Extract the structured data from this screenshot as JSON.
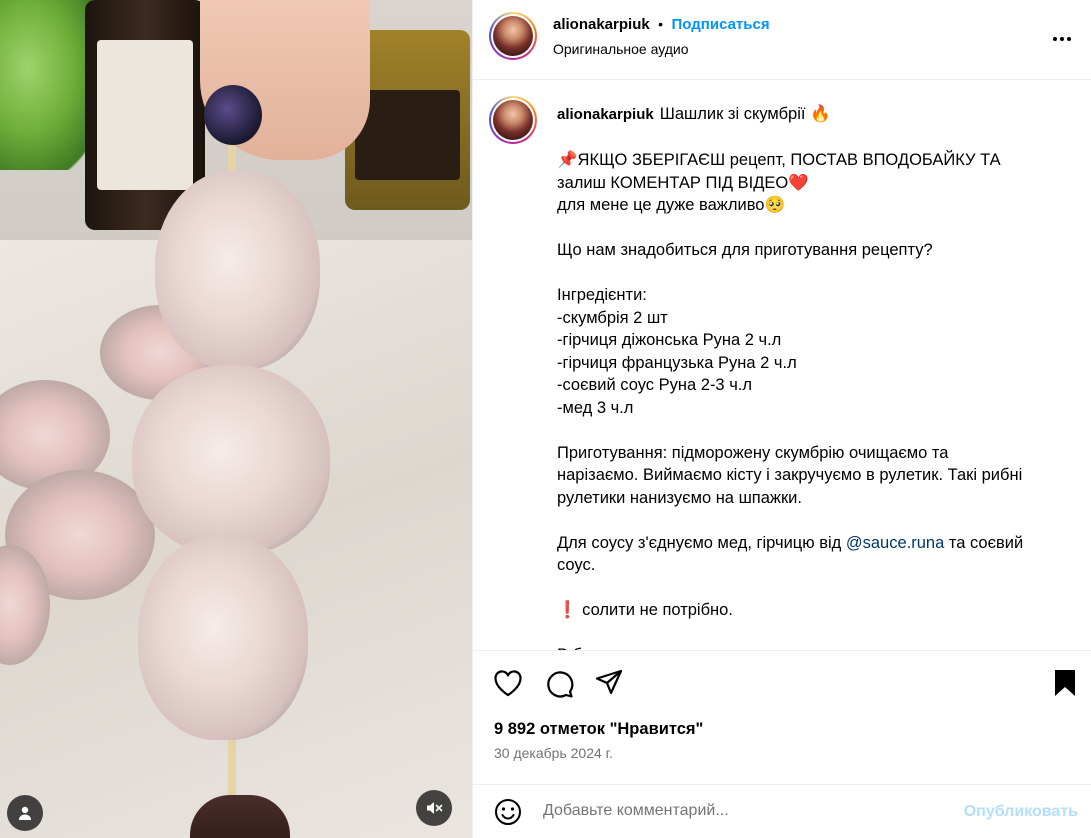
{
  "post": {
    "username": "alionakarpiuk",
    "separator": "•",
    "follow_label": "Подписаться",
    "audio": "Оригинальное аудио"
  },
  "caption": {
    "username": "alionakarpiuk",
    "title": "Шашлик зі скумбрії 🔥",
    "lines": [
      "📌ЯКЩО ЗБЕРІГАЄШ рецепт, ПОСТАВ ВПОДОБАЙКУ ТА",
      "залиш КОМЕНТАР ПІД ВІДЕО❤️",
      "для мене це дуже важливо🥺",
      "",
      "Що нам знадобиться для приготування рецепту?",
      "",
      "Інгредієнти:",
      "-скумбрія 2 шт",
      "-гірчиця діжонська Руна 2 ч.л",
      "-гірчиця французька Руна 2 ч.л",
      "-соєвий соус Руна 2-3 ч.л",
      "-мед 3 ч.л",
      "",
      "Приготування: підморожену скумбрію очищаємо та",
      "нарізаємо. Виймаємо кісту і закручуємо в рулетик. Такі рибні",
      "рулетики нанизуємо на шпажки.",
      ""
    ],
    "sauce_before": "Для соусу з'єднуємо мед, гірчицю від ",
    "sauce_link": "@sauce.runa",
    "sauce_after": " та соєвий",
    "sauce_line2": "соус.",
    "warning": "❗ солити не потрібно.",
    "cut_text": "В б"
  },
  "stats": {
    "likes": "9 892 отметок \"Нравится\"",
    "date": "30 декабрь 2024 г."
  },
  "comment": {
    "placeholder": "Добавьте комментарий...",
    "publish_label": "Опубликовать"
  },
  "icons": {
    "like": "heart-icon",
    "comment": "comment-icon",
    "share": "share-icon",
    "save": "bookmark-icon",
    "emoji": "emoji-icon",
    "more": "more-icon",
    "user_tag": "user-icon",
    "mute": "audio-muted-icon"
  },
  "colors": {
    "follow": "#0095f6",
    "link": "#00376b",
    "muted_text": "#737373",
    "publish_disabled": "#b2dffc"
  }
}
